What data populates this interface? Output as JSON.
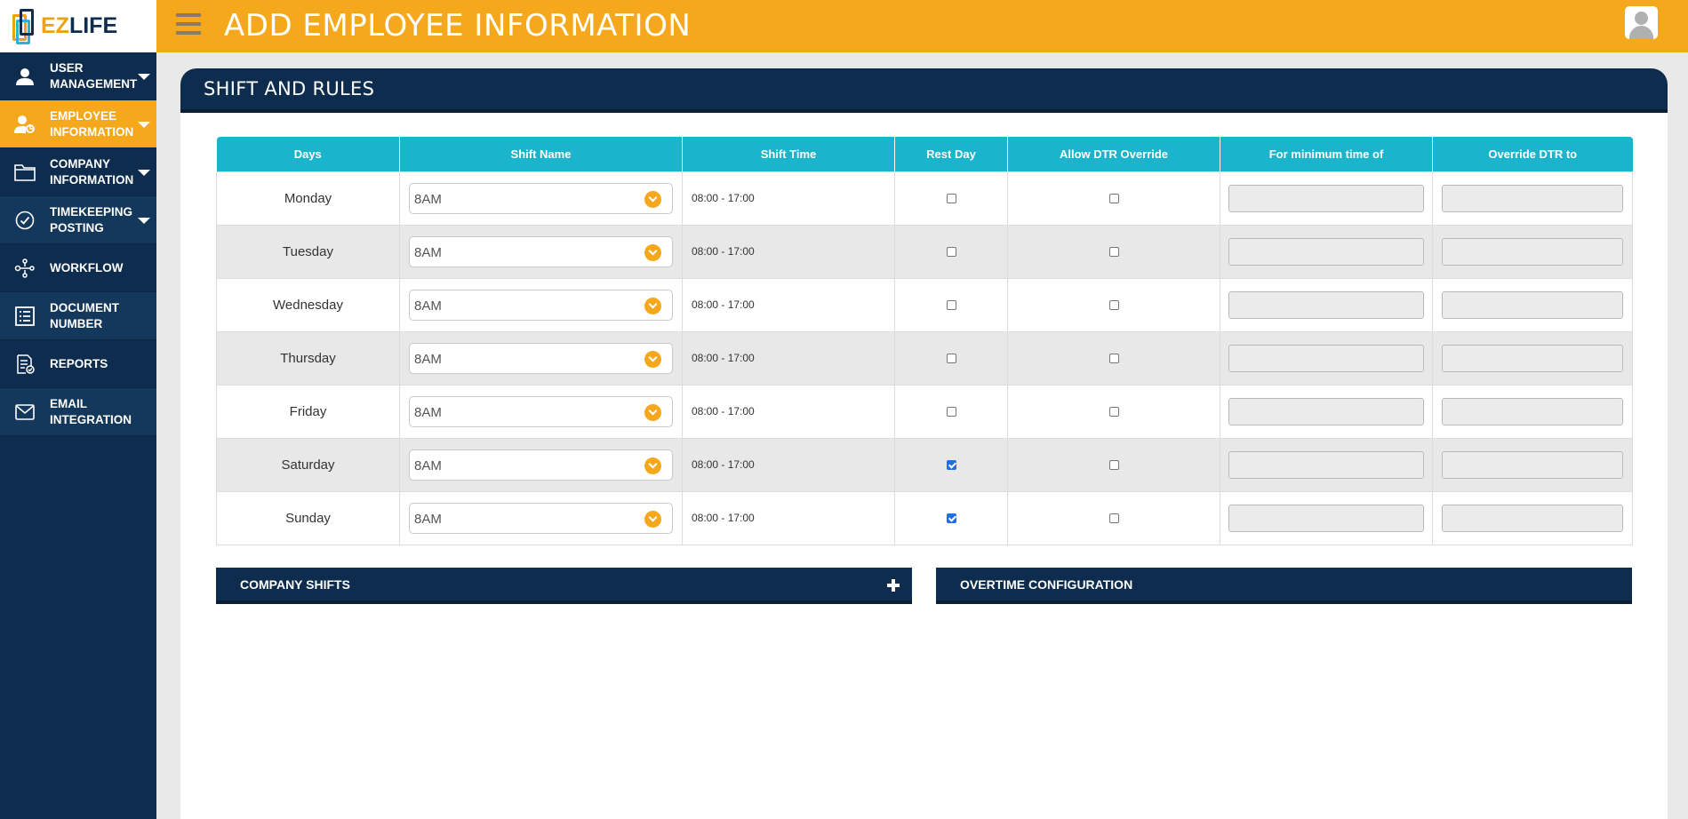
{
  "logo": {
    "ez": "EZ",
    "life": "LIFE"
  },
  "header": {
    "title": "ADD EMPLOYEE INFORMATION"
  },
  "sidebar": {
    "items": [
      {
        "label": "USER MANAGEMENT",
        "icon": "user-icon",
        "caret": true,
        "active": false
      },
      {
        "label": "EMPLOYEE INFORMATION",
        "icon": "employee-icon",
        "caret": true,
        "active": true
      },
      {
        "label": "COMPANY INFORMATION",
        "icon": "folder-icon",
        "caret": true,
        "active": false
      },
      {
        "label": "TIMEKEEPING POSTING",
        "icon": "check-circle-icon",
        "caret": true,
        "active": false
      },
      {
        "label": "WORKFLOW",
        "icon": "workflow-icon",
        "caret": false,
        "active": false
      },
      {
        "label": "DOCUMENT NUMBER",
        "icon": "document-list-icon",
        "caret": false,
        "active": false
      },
      {
        "label": "REPORTS",
        "icon": "report-icon",
        "caret": false,
        "active": false
      },
      {
        "label": "EMAIL INTEGRATION",
        "icon": "mail-icon",
        "caret": false,
        "active": false
      }
    ]
  },
  "panel": {
    "title": "SHIFT AND RULES"
  },
  "table": {
    "columns": [
      "Days",
      "Shift Name",
      "Shift Time",
      "Rest Day",
      "Allow DTR Override",
      "For minimum time of",
      "Override DTR to"
    ],
    "rows": [
      {
        "day": "Monday",
        "shift": "8AM",
        "time": "08:00 - 17:00",
        "rest_day": false,
        "allow_override": false,
        "min_time": "",
        "override_to": ""
      },
      {
        "day": "Tuesday",
        "shift": "8AM",
        "time": "08:00 - 17:00",
        "rest_day": false,
        "allow_override": false,
        "min_time": "",
        "override_to": ""
      },
      {
        "day": "Wednesday",
        "shift": "8AM",
        "time": "08:00 - 17:00",
        "rest_day": false,
        "allow_override": false,
        "min_time": "",
        "override_to": ""
      },
      {
        "day": "Thursday",
        "shift": "8AM",
        "time": "08:00 - 17:00",
        "rest_day": false,
        "allow_override": false,
        "min_time": "",
        "override_to": ""
      },
      {
        "day": "Friday",
        "shift": "8AM",
        "time": "08:00 - 17:00",
        "rest_day": false,
        "allow_override": false,
        "min_time": "",
        "override_to": ""
      },
      {
        "day": "Saturday",
        "shift": "8AM",
        "time": "08:00 - 17:00",
        "rest_day": true,
        "allow_override": false,
        "min_time": "",
        "override_to": ""
      },
      {
        "day": "Sunday",
        "shift": "8AM",
        "time": "08:00 - 17:00",
        "rest_day": true,
        "allow_override": false,
        "min_time": "",
        "override_to": ""
      }
    ]
  },
  "sections": {
    "company_shifts": "COMPANY SHIFTS",
    "overtime": "OVERTIME CONFIGURATION"
  },
  "colors": {
    "accent": "#f5a81b",
    "navy": "#0e2d4e",
    "teal": "#1ab5cc",
    "checkbox": "#1f6fe5"
  }
}
